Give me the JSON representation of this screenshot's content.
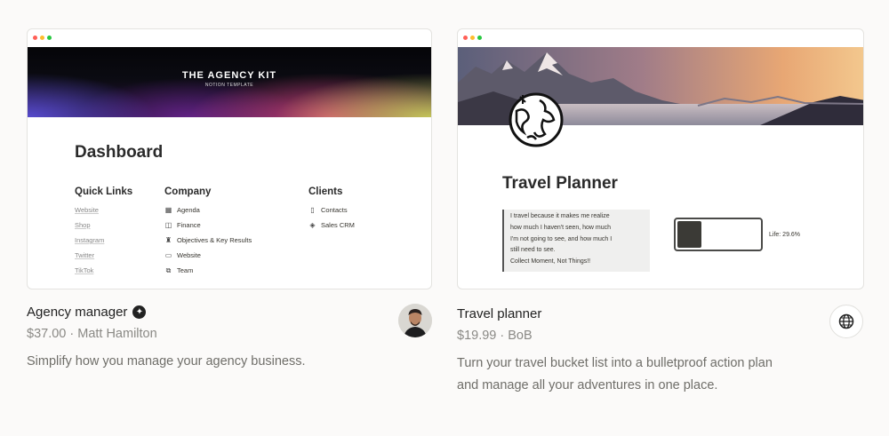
{
  "cards": [
    {
      "preview": {
        "banner_title": "THE AGENCY KIT",
        "banner_subtitle": "NOTION TEMPLATE",
        "heading": "Dashboard",
        "columns": [
          {
            "title": "Quick Links",
            "items": [
              "Website",
              "Shop",
              "Instagram",
              "Twitter",
              "TikTok"
            ]
          },
          {
            "title": "Company",
            "items": [
              {
                "icon": "calendar-icon",
                "label": "Agenda"
              },
              {
                "icon": "finance-icon",
                "label": "Finance"
              },
              {
                "icon": "target-icon",
                "label": "Objectives & Key Results"
              },
              {
                "icon": "monitor-icon",
                "label": "Website"
              },
              {
                "icon": "team-icon",
                "label": "Team"
              }
            ]
          },
          {
            "title": "Clients",
            "items": [
              {
                "icon": "phone-icon",
                "label": "Contacts"
              },
              {
                "icon": "tag-icon",
                "label": "Sales CRM"
              }
            ]
          }
        ]
      },
      "title": "Agency manager",
      "price_author": "$37.00 · Matt Hamilton",
      "description": "Simplify how you manage your agency business."
    },
    {
      "preview": {
        "heading": "Travel Planner",
        "quote_lines": [
          "I travel because it makes me realize",
          "how much I haven't seen, how much",
          "I'm not going to see, and how much I",
          "still need to see.",
          "Collect Moment, Not Things!!"
        ],
        "life_label": "Life: 29.6%",
        "life_fraction": 0.296
      },
      "title": "Travel planner",
      "price_author": "$19.99 · BoB",
      "description_lines": [
        "Turn your travel bucket list into a bulletproof action plan",
        "and manage all your adventures in one place."
      ]
    }
  ]
}
